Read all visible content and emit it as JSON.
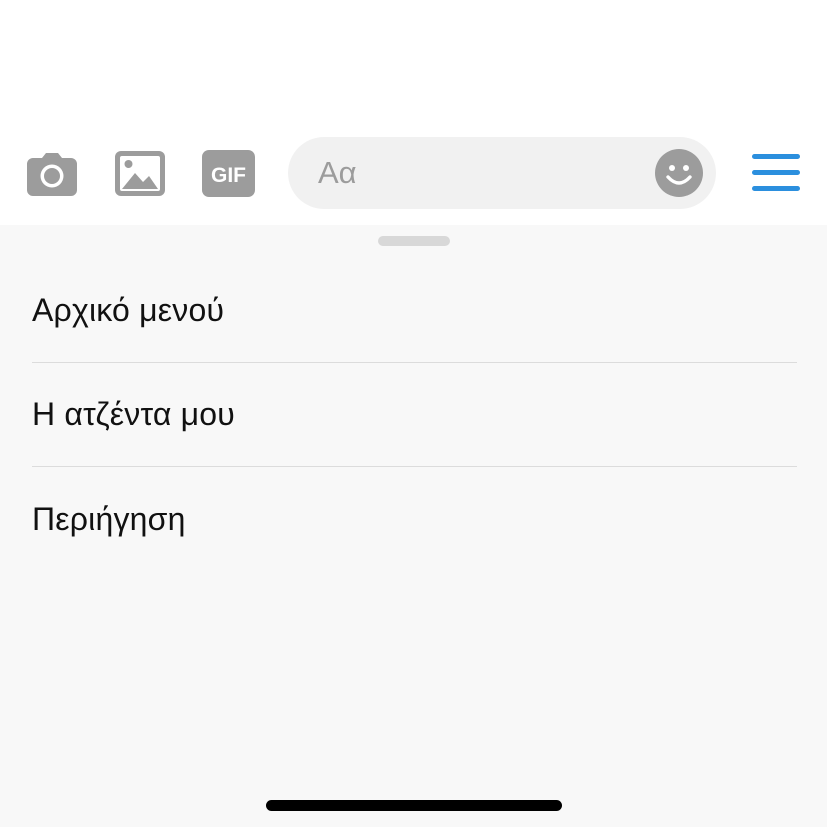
{
  "composer": {
    "camera_icon": "camera-icon",
    "photo_icon": "image-icon",
    "gif_icon": "gif-icon",
    "gif_label": "GIF",
    "message_placeholder": "Αα",
    "emoji_icon": "smiley-icon",
    "menu_icon": "hamburger-menu-icon"
  },
  "colors": {
    "icon_gray": "#9c9c9c",
    "accent_blue": "#2b8fde",
    "sheet_background": "#f8f8f8"
  },
  "menu": {
    "items": [
      {
        "label": "Αρχικό μενού"
      },
      {
        "label": "Η ατζέντα μου"
      },
      {
        "label": "Περιήγηση"
      }
    ]
  }
}
